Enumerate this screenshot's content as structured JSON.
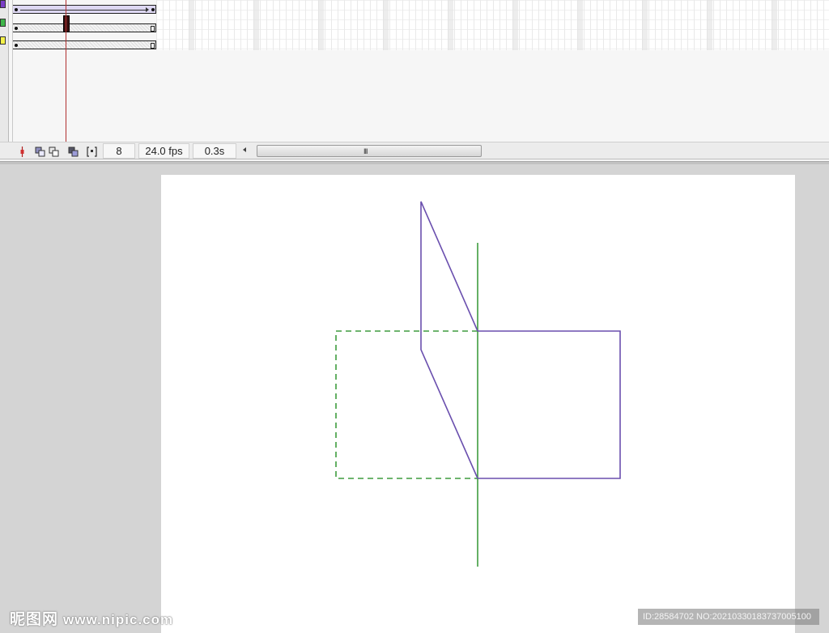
{
  "timeline": {
    "layers": [
      {
        "color": "#7b3fc6",
        "track": "tween"
      },
      {
        "color": "#3fb64a",
        "track": "hatched"
      },
      {
        "color": "#f4f24a",
        "track": "hatched"
      }
    ],
    "current_frame": "8",
    "fps": "24.0 fps",
    "elapsed": "0.3s",
    "scroll_grip": "III"
  },
  "stage": {
    "background": "#ffffff",
    "stroke_purple": "#6a4fae",
    "stroke_green": "#3e9c3e"
  },
  "watermark": {
    "logo_text": "昵图网",
    "site": "www.nipic.com",
    "id_text": "ID:28584702 NO:20210330183737005100"
  }
}
